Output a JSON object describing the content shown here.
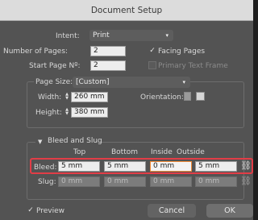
{
  "window": {
    "title": "Document Setup"
  },
  "intent": {
    "label": "Intent:",
    "value": "Print"
  },
  "pages": {
    "number_label": "Number of Pages:",
    "number_value": "2",
    "start_label": "Start Page Nº:",
    "start_value": "2",
    "facing_label": "Facing Pages",
    "facing_checked": "✓",
    "primary_text_frame_label": "Primary Text Frame"
  },
  "page_size": {
    "legend": "Page Size:",
    "value": "[Custom]",
    "width_label": "Width:",
    "width_value": "260 mm",
    "height_label": "Height:",
    "height_value": "380 mm",
    "orientation_label": "Orientation:"
  },
  "bleed_slug": {
    "legend": "Bleed and Slug",
    "columns": [
      "Top",
      "Bottom",
      "Inside",
      "Outside"
    ],
    "bleed_label": "Bleed:",
    "bleed_values": [
      "5 mm",
      "5 mm",
      "0 mm",
      "5 mm"
    ],
    "slug_label": "Slug:",
    "slug_values": [
      "0 mm",
      "0 mm",
      "0 mm",
      "0 mm"
    ]
  },
  "footer": {
    "preview_label": "Preview",
    "preview_checked": "✓",
    "cancel_label": "Cancel",
    "ok_label": "OK"
  },
  "icons": {
    "caret": "▾",
    "checkmark": "✓",
    "link": "⛓",
    "chevron_down": "▼",
    "step_up": "▲",
    "step_down": "▼"
  }
}
